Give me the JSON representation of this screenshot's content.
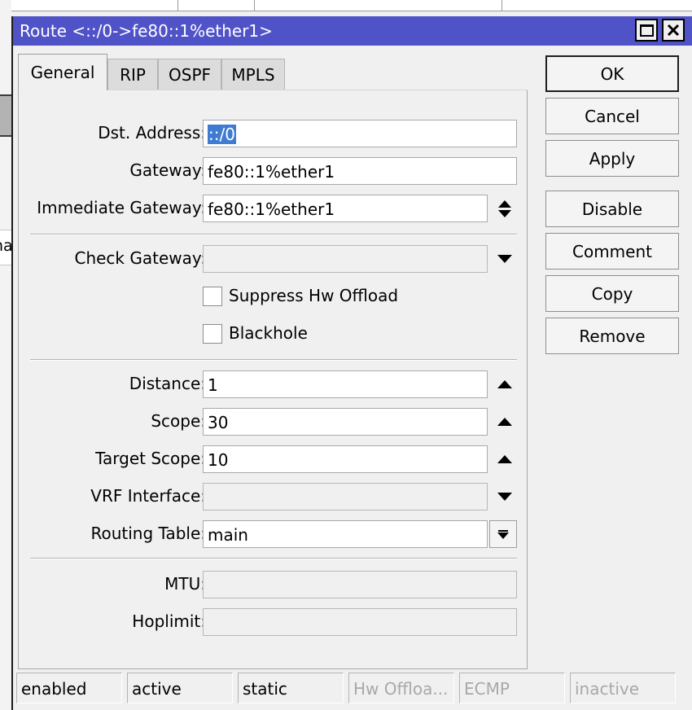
{
  "window": {
    "title": "Route <::/0->fe80::1%ether1>",
    "titlebar_color": "#5053c8"
  },
  "tabs": [
    {
      "label": "General",
      "active": true
    },
    {
      "label": "RIP"
    },
    {
      "label": "OSPF"
    },
    {
      "label": "MPLS"
    }
  ],
  "form": {
    "dst_address": {
      "label": "Dst. Address:",
      "value": "::/0"
    },
    "gateway": {
      "label": "Gateway:",
      "value": "fe80::1%ether1"
    },
    "immediate_gateway": {
      "label": "Immediate Gateway:",
      "value": "fe80::1%ether1"
    },
    "check_gateway": {
      "label": "Check Gateway:",
      "value": ""
    },
    "suppress_hw_offload": {
      "label": "Suppress Hw Offload",
      "checked": false
    },
    "blackhole": {
      "label": "Blackhole",
      "checked": false
    },
    "distance": {
      "label": "Distance:",
      "value": "1"
    },
    "scope": {
      "label": "Scope:",
      "value": "30"
    },
    "target_scope": {
      "label": "Target Scope:",
      "value": "10"
    },
    "vrf_interface": {
      "label": "VRF Interface:",
      "value": ""
    },
    "routing_table": {
      "label": "Routing Table:",
      "value": "main"
    },
    "mtu": {
      "label": "MTU:",
      "value": ""
    },
    "hoplimit": {
      "label": "Hoplimit:",
      "value": ""
    }
  },
  "buttons": {
    "ok": "OK",
    "cancel": "Cancel",
    "apply": "Apply",
    "disable": "Disable",
    "comment": "Comment",
    "copy": "Copy",
    "remove": "Remove"
  },
  "status": [
    {
      "text": "enabled",
      "dim": false
    },
    {
      "text": "active",
      "dim": false
    },
    {
      "text": "static",
      "dim": false
    },
    {
      "text": "Hw Offloa...",
      "dim": true
    },
    {
      "text": "ECMP",
      "dim": true
    },
    {
      "text": "inactive",
      "dim": true
    }
  ],
  "background": {
    "left_fragment_text": "na"
  }
}
